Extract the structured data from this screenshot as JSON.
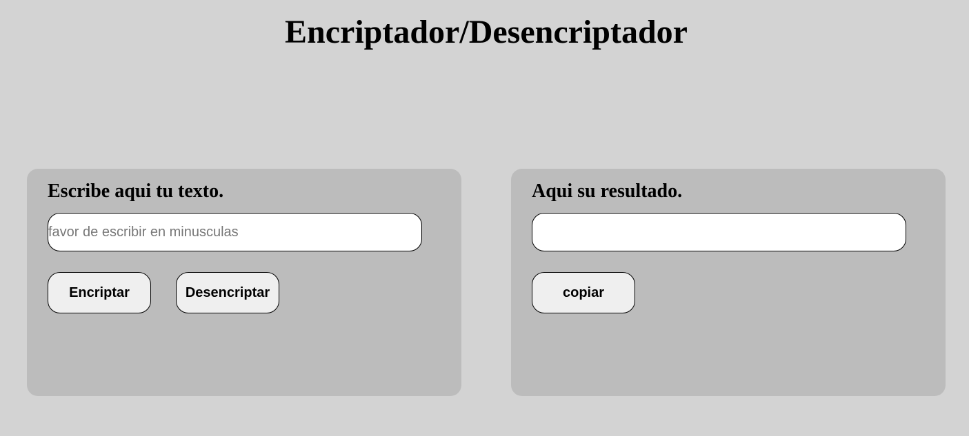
{
  "header": {
    "title": "Encriptador/Desencriptador"
  },
  "input_panel": {
    "heading": "Escribe aqui tu texto.",
    "input": {
      "value": "",
      "placeholder": "favor de escribir en minusculas"
    },
    "encrypt_label": "Encriptar",
    "decrypt_label": "Desencriptar"
  },
  "output_panel": {
    "heading": "Aqui su resultado.",
    "output": {
      "value": "",
      "placeholder": ""
    },
    "copy_label": "copiar"
  },
  "colors": {
    "page_background": "#d3d3d3",
    "panel_background": "#bcbcbc",
    "button_background": "#efefef",
    "field_background": "#ffffff"
  }
}
